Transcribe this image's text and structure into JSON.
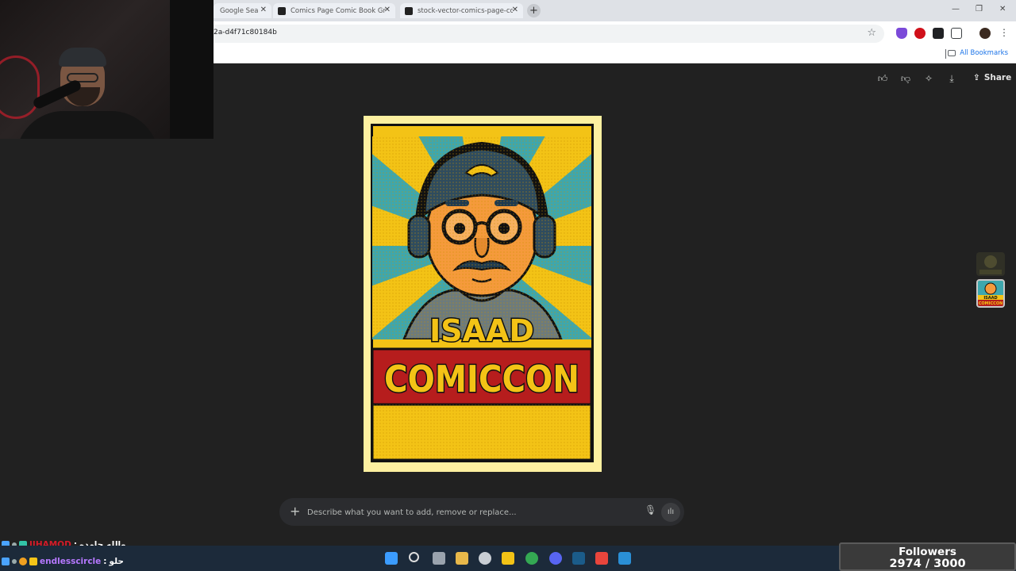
{
  "browser": {
    "tabs": [
      {
        "title": "Google Sea"
      },
      {
        "title": "Comics Page Comic Book Grid"
      },
      {
        "title": "stock-vector-comics-page-con"
      }
    ],
    "address": "2a-d4f71c80184b",
    "bookmarks_label": "All Bookmarks"
  },
  "viewer": {
    "share_label": "Share"
  },
  "poster": {
    "name_text": "ISAAD",
    "event_text": "COMICCON",
    "thumb_text_top": "ISAAD",
    "thumb_text_bottom": "COMICCON",
    "colors": {
      "yellow": "#f3c316",
      "teal": "#3ea7ad",
      "red": "#b61d1d",
      "navy": "#1e3a50"
    }
  },
  "prompt": {
    "placeholder": "Describe what you want to add, remove or replace..."
  },
  "chat": [
    {
      "user": "IIHAMOD",
      "separator": ":",
      "message": "والله جامده",
      "color": "#d31b2a"
    },
    {
      "user": "endlesscircle",
      "separator": ":",
      "message": "حلو",
      "color": "#b678ff"
    }
  ],
  "followers": {
    "label": "Followers",
    "count": "2974 / 3000",
    "current": 2974,
    "goal": 3000
  }
}
